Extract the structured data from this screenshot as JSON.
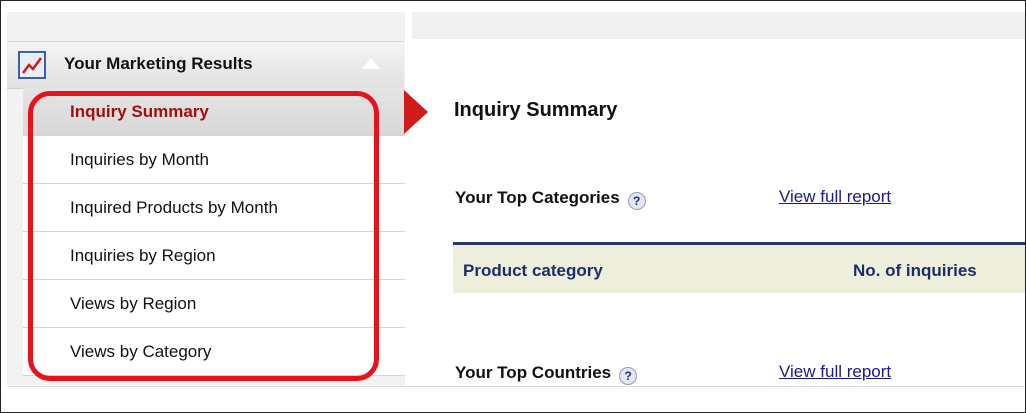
{
  "sidebar": {
    "header": {
      "label": "Your Marketing Results",
      "icon": "chart-trend-icon"
    },
    "items": [
      {
        "label": "Inquiry Summary",
        "active": true
      },
      {
        "label": "Inquiries by Month",
        "active": false
      },
      {
        "label": "Inquired Products by Month",
        "active": false
      },
      {
        "label": "Inquiries by Region",
        "active": false
      },
      {
        "label": "Views by Region",
        "active": false
      },
      {
        "label": "Views by Category",
        "active": false
      }
    ]
  },
  "main": {
    "title": "Inquiry Summary",
    "top_categories": {
      "label": "Your Top Categories",
      "link": "View full report",
      "columns": [
        "Product category",
        "No. of inquiries"
      ]
    },
    "top_countries": {
      "label": "Your Top Countries",
      "link": "View full report"
    },
    "help_glyph": "?"
  },
  "colors": {
    "active_text": "#a01010",
    "highlight": "#e8121a",
    "table_header_bg": "#eeeedd",
    "table_header_text": "#1e2b6e",
    "link": "#1a1a8c"
  }
}
